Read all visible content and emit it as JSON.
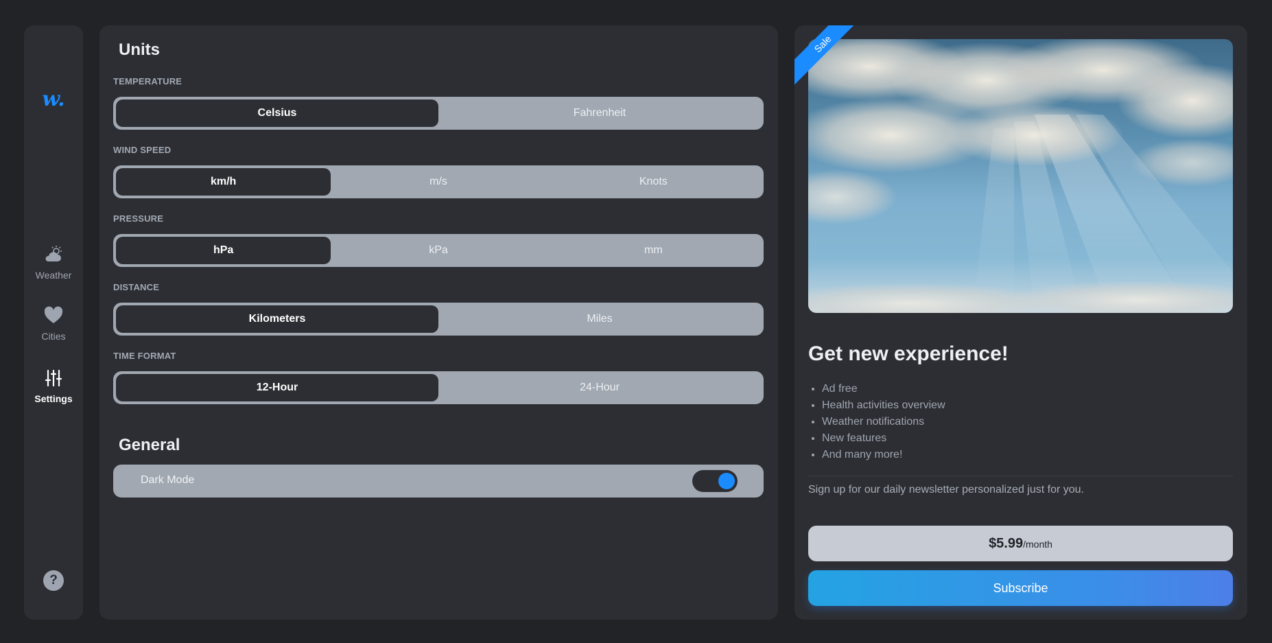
{
  "sidebar": {
    "logo": "w.",
    "nav": [
      {
        "label": "Weather",
        "icon": "partly-cloudy-icon",
        "active": false
      },
      {
        "label": "Cities",
        "icon": "heart-icon",
        "active": false
      },
      {
        "label": "Settings",
        "icon": "sliders-icon",
        "active": true
      }
    ],
    "help": "?"
  },
  "units": {
    "title": "Units",
    "temperature": {
      "label": "TEMPERATURE",
      "options": [
        "Celsius",
        "Fahrenheit"
      ],
      "selected": "Celsius"
    },
    "wind_speed": {
      "label": "WIND SPEED",
      "options": [
        "km/h",
        "m/s",
        "Knots"
      ],
      "selected": "km/h"
    },
    "pressure": {
      "label": "PRESSURE",
      "options": [
        "hPa",
        "kPa",
        "mm"
      ],
      "selected": "hPa"
    },
    "distance": {
      "label": "DISTANCE",
      "options": [
        "Kilometers",
        "Miles"
      ],
      "selected": "Kilometers"
    },
    "time_format": {
      "label": "TIME FORMAT",
      "options": [
        "12-Hour",
        "24-Hour"
      ],
      "selected": "12-Hour"
    }
  },
  "general": {
    "title": "General",
    "dark_mode": {
      "label": "Dark Mode",
      "enabled": true
    }
  },
  "promo": {
    "ribbon": "Sale",
    "title": "Get new experience!",
    "features": [
      "Ad free",
      "Health activities overview",
      "Weather notifications",
      "New features",
      "And many more!"
    ],
    "newsletter": "Sign up for our daily newsletter personalized just for you.",
    "price": "$5.99",
    "period": "/month",
    "subscribe": "Subscribe"
  },
  "colors": {
    "accent": "#1a8cff",
    "panel": "#2d2e33",
    "background": "#222326",
    "segment": "#a1a8b2"
  }
}
